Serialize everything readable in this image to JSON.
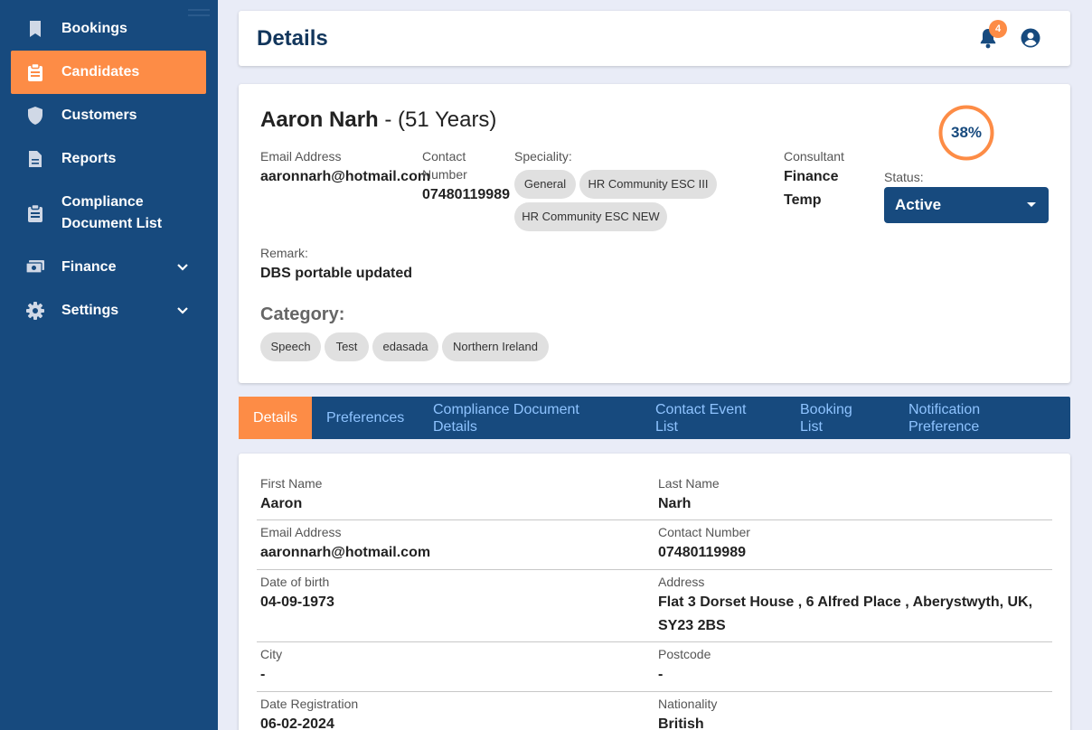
{
  "sidebar": {
    "items": [
      {
        "label": "Bookings",
        "icon": "bookmark-icon"
      },
      {
        "label": "Candidates",
        "icon": "clipboard-icon",
        "active": true
      },
      {
        "label": "Customers",
        "icon": "shield-icon"
      },
      {
        "label": "Reports",
        "icon": "document-icon"
      },
      {
        "label": "Compliance Document List",
        "icon": "clipboard-icon"
      },
      {
        "label": "Finance",
        "icon": "money-icon",
        "expandable": true
      },
      {
        "label": "Settings",
        "icon": "gear-icon",
        "expandable": true
      }
    ]
  },
  "header": {
    "title": "Details",
    "notification_count": "4"
  },
  "profile": {
    "name": "Aaron Narh",
    "age_text": " - (51 Years)",
    "completion": "38%",
    "completion_fraction": 0.38,
    "email_label": "Email Address",
    "email": "aaronnarh@hotmail.com",
    "contact_label_1": "Contact",
    "contact_label_2": "Number",
    "contact": "07480119989",
    "speciality_label": "Speciality:",
    "specialities": [
      "General",
      "HR Community ESC III",
      "HR Community ESC NEW"
    ],
    "consultant_label": "Consultant",
    "consultant_line1": "Finance",
    "consultant_line2": "Temp",
    "status_label": "Status:",
    "status_value": "Active",
    "remark_label": "Remark:",
    "remark": "DBS portable updated",
    "category_label": "Category:",
    "categories": [
      "Speech",
      "Test",
      "edasada",
      "Northern Ireland"
    ]
  },
  "tabs": [
    {
      "line1": "Details",
      "line2": ""
    },
    {
      "line1": "Preferences",
      "line2": ""
    },
    {
      "line1": "Compliance Document",
      "line2": "Details"
    },
    {
      "line1": "Contact Event",
      "line2": "List"
    },
    {
      "line1": "Booking",
      "line2": "List"
    },
    {
      "line1": "Notification",
      "line2": "Preference"
    }
  ],
  "details": {
    "first_name_label": "First Name",
    "first_name": "Aaron",
    "last_name_label": "Last Name",
    "last_name": "Narh",
    "email_label": "Email Address",
    "email": "aaronnarh@hotmail.com",
    "contact_label": "Contact Number",
    "contact": "07480119989",
    "dob_label": "Date of birth",
    "dob": "04-09-1973",
    "address_label": "Address",
    "address_line1": "Flat 3 Dorset House , 6 Alfred Place , Aberystwyth, UK,",
    "address_line2": "SY23 2BS",
    "city_label": "City",
    "city": "-",
    "postcode_label": "Postcode",
    "postcode": "-",
    "date_reg_label": "Date Registration",
    "date_reg": "06-02-2024",
    "nationality_label": "Nationality",
    "nationality": "British"
  },
  "colors": {
    "primary": "#174a7e",
    "accent": "#fd8c46",
    "background": "#e9ecf7"
  }
}
